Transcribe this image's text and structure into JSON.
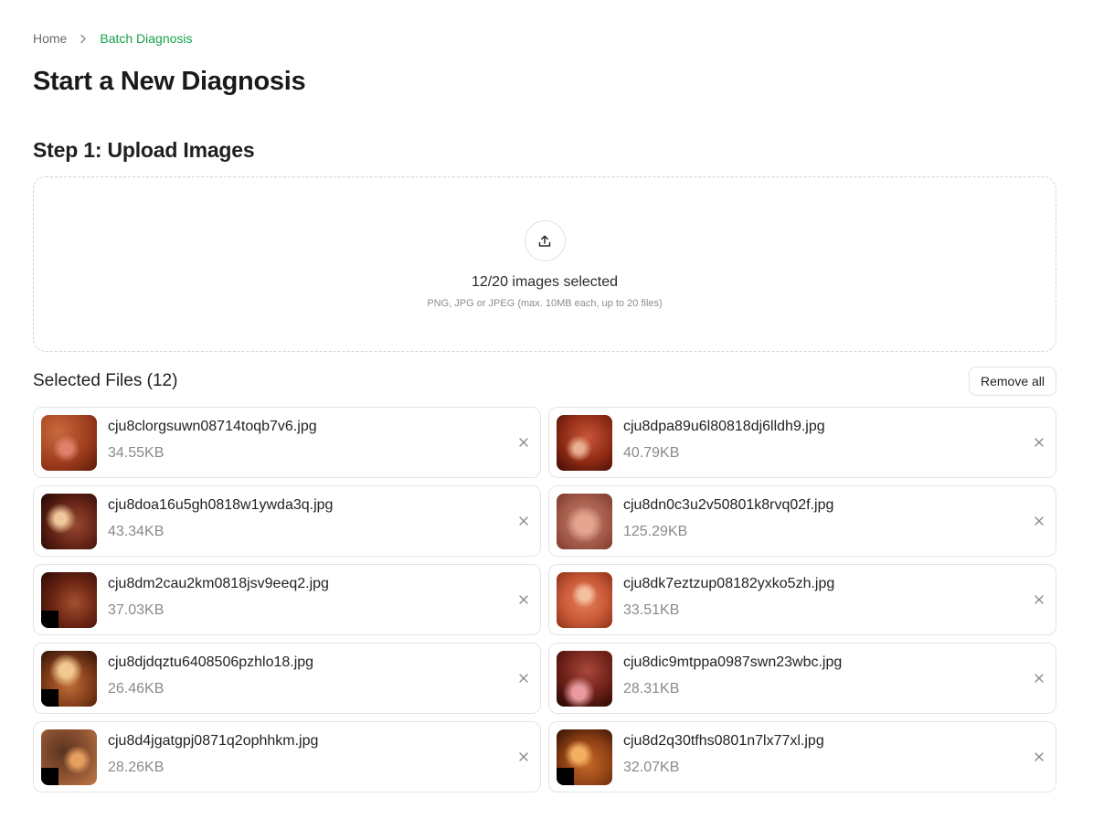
{
  "breadcrumb": {
    "home": "Home",
    "current": "Batch Diagnosis"
  },
  "page_title": "Start a New Diagnosis",
  "step1": {
    "title": "Step 1: Upload Images",
    "count_text": "12/20 images selected",
    "hint": "PNG, JPG or JPEG (max. 10MB each, up to 20 files)"
  },
  "files": {
    "title": "Selected Files (12)",
    "remove_all": "Remove all",
    "items": [
      {
        "name": "cju8clorgsuwn08714toqb7v6.jpg",
        "size": "34.55KB"
      },
      {
        "name": "cju8dpa89u6l80818dj6lldh9.jpg",
        "size": "40.79KB"
      },
      {
        "name": "cju8doa16u5gh0818w1ywda3q.jpg",
        "size": "43.34KB"
      },
      {
        "name": "cju8dn0c3u2v50801k8rvq02f.jpg",
        "size": "125.29KB"
      },
      {
        "name": "cju8dm2cau2km0818jsv9eeq2.jpg",
        "size": "37.03KB"
      },
      {
        "name": "cju8dk7eztzup08182yxko5zh.jpg",
        "size": "33.51KB"
      },
      {
        "name": "cju8djdqztu6408506pzhlo18.jpg",
        "size": "26.46KB"
      },
      {
        "name": "cju8dic9mtppa0987swn23wbc.jpg",
        "size": "28.31KB"
      },
      {
        "name": "cju8d4jgatgpj0871q2ophhkm.jpg",
        "size": "28.26KB"
      },
      {
        "name": "cju8d2q30tfhs0801n7lx77xl.jpg",
        "size": "32.07KB"
      }
    ]
  },
  "colors": {
    "accent": "#16a34a",
    "border": "#e4e4e4",
    "muted": "#8a8a8a"
  }
}
